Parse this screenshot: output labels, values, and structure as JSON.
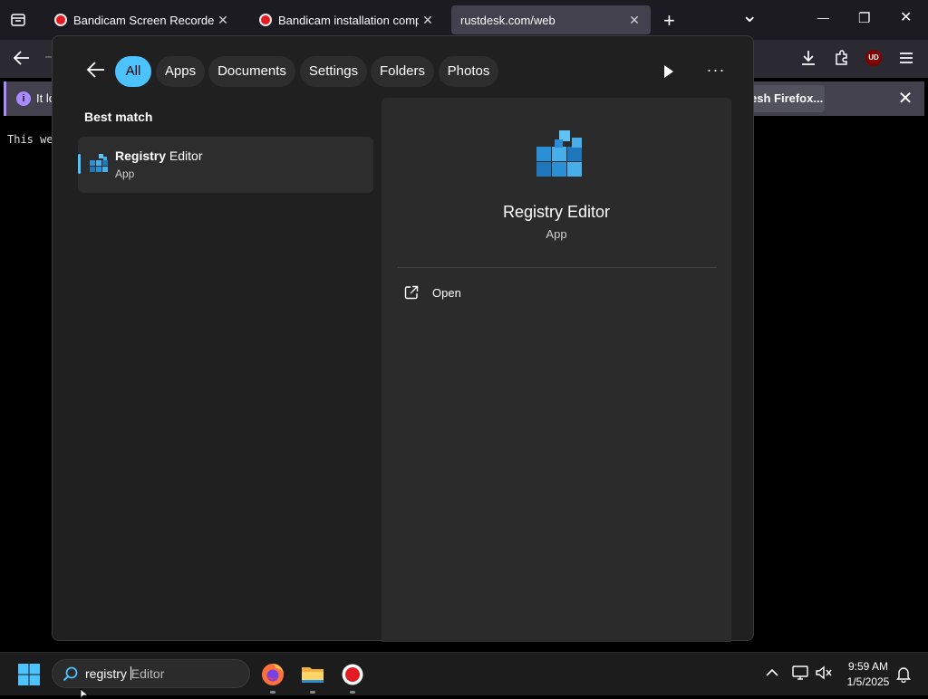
{
  "browser": {
    "tabs": [
      {
        "title": "Bandicam Screen Recorder Dow",
        "close": "✕"
      },
      {
        "title": "Bandicam installation complete",
        "close": "✕"
      },
      {
        "title": "rustdesk.com/web",
        "close": "✕"
      }
    ],
    "new_tab": "+",
    "tab_list": "⌄",
    "window_controls": {
      "minimize": "—",
      "restore": "❐",
      "close": "✕"
    },
    "notice": {
      "icon": "i",
      "text": "It lo",
      "refresh_button": "esh Firefox...",
      "close": "✕"
    },
    "page_text": "This we",
    "ublock_badge": "UD"
  },
  "search_panel": {
    "filters": [
      "All",
      "Apps",
      "Documents",
      "Settings",
      "Folders",
      "Photos"
    ],
    "more": "···",
    "best_match_heading": "Best match",
    "result": {
      "name_bold": "Registry",
      "name_rest": " Editor",
      "type": "App"
    },
    "details": {
      "name": "Registry Editor",
      "type": "App",
      "actions": [
        {
          "label": "Open",
          "icon": "open-external-icon"
        }
      ]
    }
  },
  "taskbar": {
    "search": {
      "typed": "registry ",
      "suggestion": "Editor"
    },
    "apps": [
      "firefox-icon",
      "file-explorer-icon",
      "bandicam-icon"
    ],
    "clock": {
      "time": "9:59 AM",
      "date": "1/5/2025"
    }
  },
  "colors": {
    "accent": "#4cc2ff",
    "panel": "#202020",
    "detail_pane": "#2b2b2b",
    "taskbar": "#1c1c1c"
  }
}
